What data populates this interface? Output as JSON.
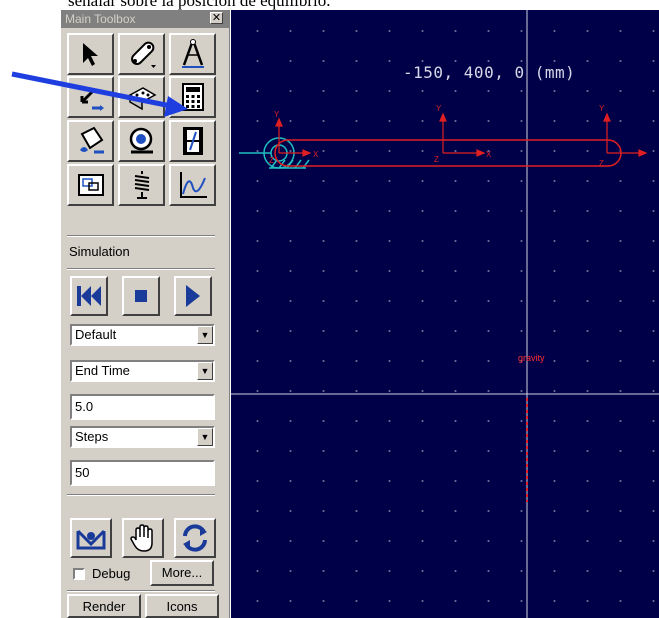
{
  "caption": "señalar sobre la posición de equilibrio.",
  "toolbox": {
    "title": "Main Toolbox",
    "close_glyph": "✕",
    "tools": [
      {
        "icon": "select-arrow-icon"
      },
      {
        "icon": "link-part-icon"
      },
      {
        "icon": "compass-measure-icon"
      },
      {
        "icon": "joint-icon"
      },
      {
        "icon": "dice-pattern-icon"
      },
      {
        "icon": "calculator-icon"
      },
      {
        "icon": "paint-bucket-icon"
      },
      {
        "icon": "view-camera-icon"
      },
      {
        "icon": "film-strip-icon"
      },
      {
        "icon": "window-layout-icon"
      },
      {
        "icon": "spring-icon"
      },
      {
        "icon": "graph-plot-icon"
      }
    ],
    "simulation_label": "Simulation",
    "playback": [
      "rewind-icon",
      "stop-icon",
      "play-icon"
    ],
    "settings_select": "Default",
    "end_mode_select": "End Time",
    "end_time_value": "5.0",
    "steps_mode_select": "Steps",
    "steps_value": "50",
    "interaction_tools": [
      "reset-model-icon",
      "hand-grab-icon",
      "refresh-cycle-icon"
    ],
    "debug_label": "Debug",
    "debug_checked": false,
    "more_button": "More...",
    "render_button": "Render",
    "icons_button": "Icons"
  },
  "canvas": {
    "coordinate_readout": "-150, 400, 0 (mm)",
    "gravity_label": "gravity",
    "background_color": "#000048",
    "link_color": "#e02020",
    "ground_color": "#20c0c0"
  }
}
